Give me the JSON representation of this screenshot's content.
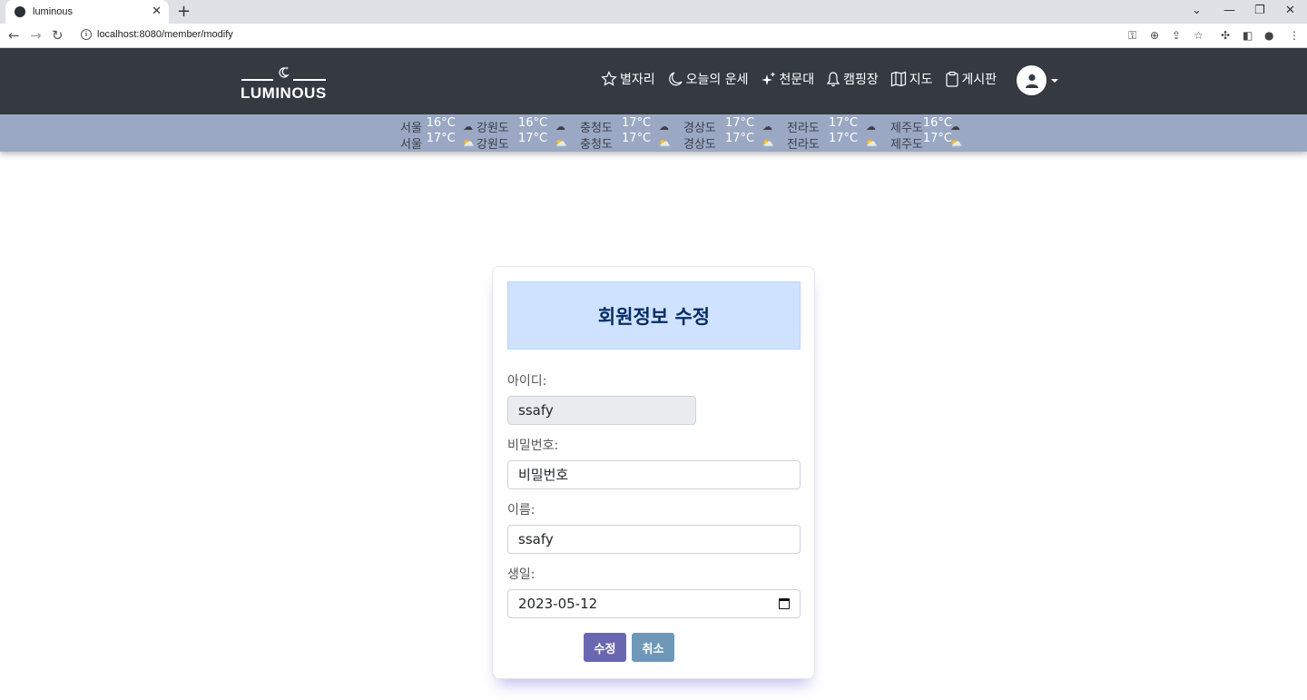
{
  "browser": {
    "tab_title": "luminous",
    "tab_close": "✕",
    "new_tab": "+",
    "url": "localhost:8080/member/modify",
    "window_controls": [
      "⌄",
      "—",
      "❐",
      "✕"
    ]
  },
  "navbar": {
    "logo_text": "LUMINOUS",
    "links": [
      {
        "label": "별자리",
        "icon": "star-icon"
      },
      {
        "label": "오늘의 운세",
        "icon": "moon-icon"
      },
      {
        "label": "천문대",
        "icon": "sparkles-icon"
      },
      {
        "label": "캠핑장",
        "icon": "bell-icon"
      },
      {
        "label": "지도",
        "icon": "map-icon"
      },
      {
        "label": "게시판",
        "icon": "clipboard-icon"
      }
    ],
    "user_menu_icon": "person-circle-icon"
  },
  "weather": {
    "row1": [
      {
        "region": "서울",
        "temp": "16°C",
        "icon": "cloud-icon"
      },
      {
        "region": "강원도",
        "temp": "16°C",
        "icon": "cloud-icon"
      },
      {
        "region": "충청도",
        "temp": "17°C",
        "icon": "cloud-icon"
      },
      {
        "region": "경상도",
        "temp": "17°C",
        "icon": "cloud-icon"
      },
      {
        "region": "전라도",
        "temp": "17°C",
        "icon": "cloud-icon"
      },
      {
        "region": "제주도",
        "temp": "16°C",
        "icon": "cloud-icon"
      }
    ],
    "row2": [
      {
        "region": "서울",
        "temp": "17°C",
        "icon": "sun-cloud-icon"
      },
      {
        "region": "강원도",
        "temp": "17°C",
        "icon": "sun-cloud-icon"
      },
      {
        "region": "충청도",
        "temp": "17°C",
        "icon": "sun-cloud-icon"
      },
      {
        "region": "경상도",
        "temp": "17°C",
        "icon": "sun-cloud-icon"
      },
      {
        "region": "전라도",
        "temp": "17°C",
        "icon": "sun-cloud-icon"
      },
      {
        "region": "제주도",
        "temp": "17°C",
        "icon": "sun-cloud-icon"
      }
    ]
  },
  "form": {
    "title": "회원정보 수정",
    "id_label": "아이디:",
    "id_value": "ssafy",
    "password_label": "비밀번호:",
    "password_placeholder": "비밀번호",
    "name_label": "이름:",
    "name_value": "ssafy",
    "birth_label": "생일:",
    "birth_value": "2023-05-12",
    "submit_label": "수정",
    "cancel_label": "취소"
  },
  "colors": {
    "navbar_bg": "#343a40",
    "weather_bg": "#9aa8c4",
    "header_bg": "#cfe2ff",
    "title_color": "#052c65",
    "submit_bg": "#6a67b0",
    "cancel_bg": "#6d98b8"
  }
}
